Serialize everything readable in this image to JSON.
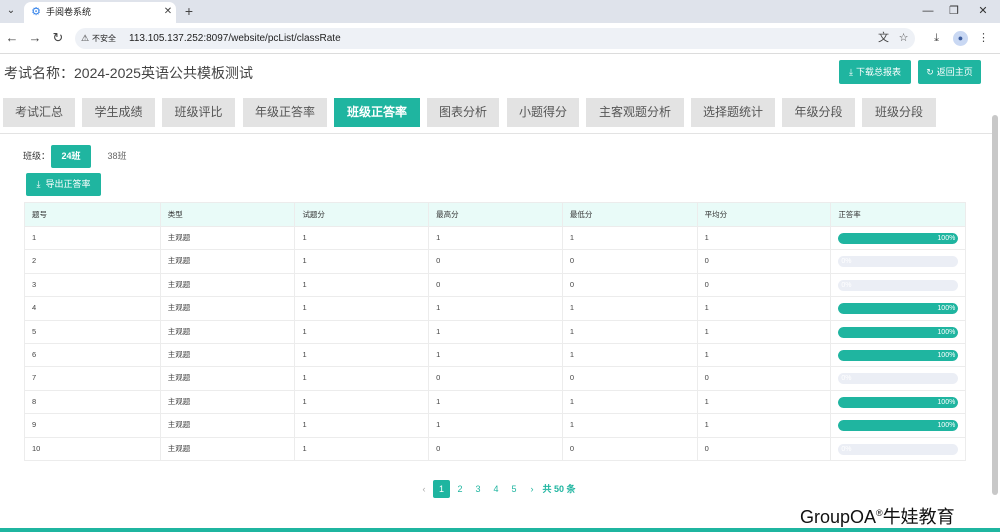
{
  "browser": {
    "tab_title": "手阅卷系统",
    "insecure_label": "不安全",
    "url": "113.105.137.252:8097/website/pcList/classRate"
  },
  "header": {
    "exam_title": "考试名称：2024-2025英语公共模板测试",
    "download_label": "下载总报表",
    "home_label": "返回主页"
  },
  "nav_tabs": [
    "考试汇总",
    "学生成绩",
    "班级评比",
    "年级正答率",
    "班级正答率",
    "图表分析",
    "小题得分",
    "主客观题分析",
    "选择题统计",
    "年级分段",
    "班级分段"
  ],
  "active_tab_index": 4,
  "class_filter": {
    "label": "班级：",
    "options": [
      "24班",
      "38班"
    ],
    "active_index": 0
  },
  "export_label": "导出正答率",
  "table": {
    "headers": [
      "题号",
      "类型",
      "试题分",
      "最高分",
      "最低分",
      "平均分",
      "正答率"
    ],
    "rows": [
      {
        "no": "1",
        "type": "主观题",
        "score": "1",
        "max": "1",
        "min": "1",
        "avg": "1",
        "rate": 100,
        "rate_label": "100%"
      },
      {
        "no": "2",
        "type": "主观题",
        "score": "1",
        "max": "0",
        "min": "0",
        "avg": "0",
        "rate": 0,
        "rate_label": "0%"
      },
      {
        "no": "3",
        "type": "主观题",
        "score": "1",
        "max": "0",
        "min": "0",
        "avg": "0",
        "rate": 0,
        "rate_label": "0%"
      },
      {
        "no": "4",
        "type": "主观题",
        "score": "1",
        "max": "1",
        "min": "1",
        "avg": "1",
        "rate": 100,
        "rate_label": "100%"
      },
      {
        "no": "5",
        "type": "主观题",
        "score": "1",
        "max": "1",
        "min": "1",
        "avg": "1",
        "rate": 100,
        "rate_label": "100%"
      },
      {
        "no": "6",
        "type": "主观题",
        "score": "1",
        "max": "1",
        "min": "1",
        "avg": "1",
        "rate": 100,
        "rate_label": "100%"
      },
      {
        "no": "7",
        "type": "主观题",
        "score": "1",
        "max": "0",
        "min": "0",
        "avg": "0",
        "rate": 0,
        "rate_label": "0%"
      },
      {
        "no": "8",
        "type": "主观题",
        "score": "1",
        "max": "1",
        "min": "1",
        "avg": "1",
        "rate": 100,
        "rate_label": "100%"
      },
      {
        "no": "9",
        "type": "主观题",
        "score": "1",
        "max": "1",
        "min": "1",
        "avg": "1",
        "rate": 100,
        "rate_label": "100%"
      },
      {
        "no": "10",
        "type": "主观题",
        "score": "1",
        "max": "0",
        "min": "0",
        "avg": "0",
        "rate": 0,
        "rate_label": "0%"
      }
    ]
  },
  "pagination": {
    "pages": [
      "1",
      "2",
      "3",
      "4",
      "5"
    ],
    "active_index": 0,
    "total_label": "共 50 条"
  },
  "watermark": {
    "brand": "GroupOA",
    "reg": "®",
    "name": "牛娃教育"
  },
  "colors": {
    "accent": "#1fb5a0",
    "header_row": "#e9fbf8"
  },
  "icons": {
    "tab_favicon": "gear-icon",
    "download": "download-icon",
    "home": "refresh-icon",
    "export": "download-icon"
  }
}
